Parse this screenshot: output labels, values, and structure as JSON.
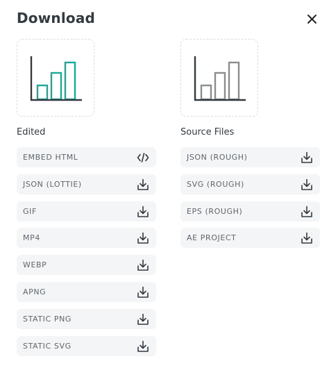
{
  "dialog": {
    "title": "Download",
    "close_icon": "close-icon"
  },
  "colors": {
    "accent": "#1aa89a",
    "muted": "#8c8c8c",
    "axis": "#333a40",
    "text": "#333a40",
    "item_bg": "#f4f5f6"
  },
  "edited": {
    "label": "Edited",
    "items": [
      {
        "label": "EMBED HTML",
        "icon": "code-icon"
      },
      {
        "label": "JSON (LOTTIE)",
        "icon": "download-icon"
      },
      {
        "label": "GIF",
        "icon": "download-icon"
      },
      {
        "label": "MP4",
        "icon": "download-icon"
      },
      {
        "label": "WEBP",
        "icon": "download-icon"
      },
      {
        "label": "APNG",
        "icon": "download-icon"
      },
      {
        "label": "STATIC PNG",
        "icon": "download-icon"
      },
      {
        "label": "STATIC SVG",
        "icon": "download-icon"
      }
    ]
  },
  "source": {
    "label": "Source Files",
    "items": [
      {
        "label": "JSON (ROUGH)",
        "icon": "download-icon"
      },
      {
        "label": "SVG (ROUGH)",
        "icon": "download-icon"
      },
      {
        "label": "EPS (ROUGH)",
        "icon": "download-icon"
      },
      {
        "label": "AE PROJECT",
        "icon": "download-icon"
      }
    ]
  }
}
